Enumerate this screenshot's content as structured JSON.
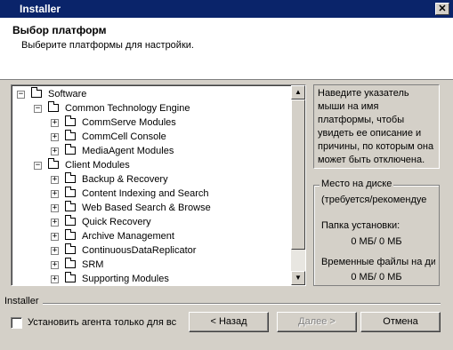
{
  "window": {
    "title": "Installer",
    "close_glyph": "✕"
  },
  "header": {
    "title": "Выбор платформ",
    "subtitle": "Выберите платформы для настройки."
  },
  "tree": {
    "items": [
      {
        "label": "Software",
        "level": 0,
        "expander": "−"
      },
      {
        "label": "Common Technology Engine",
        "level": 1,
        "expander": "−"
      },
      {
        "label": "CommServe Modules",
        "level": 2,
        "expander": "+"
      },
      {
        "label": "CommCell Console",
        "level": 2,
        "expander": "+"
      },
      {
        "label": "MediaAgent Modules",
        "level": 2,
        "expander": "+"
      },
      {
        "label": "Client Modules",
        "level": 1,
        "expander": "−"
      },
      {
        "label": "Backup & Recovery",
        "level": 2,
        "expander": "+"
      },
      {
        "label": "Content Indexing and Search",
        "level": 2,
        "expander": "+"
      },
      {
        "label": "Web Based Search & Browse",
        "level": 2,
        "expander": "+"
      },
      {
        "label": "Quick Recovery",
        "level": 2,
        "expander": "+"
      },
      {
        "label": "Archive Management",
        "level": 2,
        "expander": "+"
      },
      {
        "label": "ContinuousDataReplicator",
        "level": 2,
        "expander": "+"
      },
      {
        "label": "SRM",
        "level": 2,
        "expander": "+"
      },
      {
        "label": "Supporting Modules",
        "level": 2,
        "expander": "+"
      }
    ],
    "scroll_up_glyph": "▲",
    "scroll_down_glyph": "▼"
  },
  "description": {
    "text": "Наведите указатель мыши на имя платформы, чтобы увидеть ее описание и причины, по которым она может быть отключена."
  },
  "disk": {
    "legend": "Место на диске",
    "required_label": "(требуется/рекомендуе",
    "install_folder_label": "Папка установки:",
    "install_folder_value": "0 МБ/ 0 МБ",
    "temp_files_label": "Временные файлы на ди",
    "temp_files_value": "0 МБ/ 0 МБ"
  },
  "footer": {
    "divider_label": "Installer",
    "checkbox_label": "Установить агента только для вс",
    "back_button": "< Назад",
    "next_button": "Далее >",
    "cancel_button": "Отмена"
  }
}
